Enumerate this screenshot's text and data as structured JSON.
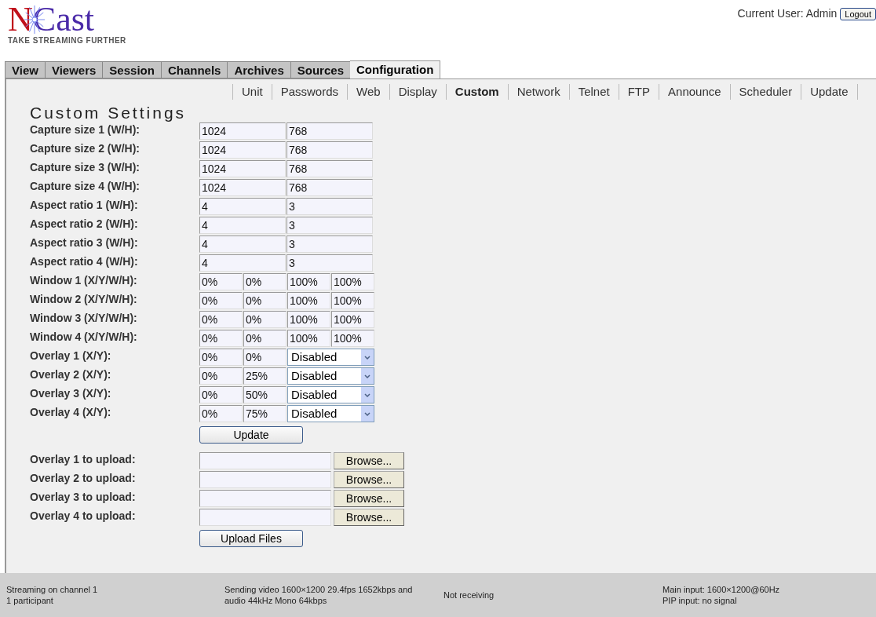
{
  "logo": {
    "name": "NCast",
    "tagline": "TAKE STREAMING FURTHER"
  },
  "user": {
    "label": "Current User: Admin",
    "logout": "Logout"
  },
  "tabs": [
    {
      "label": "View",
      "selected": false
    },
    {
      "label": "Viewers",
      "selected": false
    },
    {
      "label": "Session",
      "selected": false
    },
    {
      "label": "Channels",
      "selected": false
    },
    {
      "label": "Archives",
      "selected": false
    },
    {
      "label": "Sources",
      "selected": false
    },
    {
      "label": "Configuration",
      "selected": true
    }
  ],
  "subtabs": [
    {
      "label": "Unit",
      "selected": false
    },
    {
      "label": "Passwords",
      "selected": false
    },
    {
      "label": "Web",
      "selected": false
    },
    {
      "label": "Display",
      "selected": false
    },
    {
      "label": "Custom",
      "selected": true
    },
    {
      "label": "Network",
      "selected": false
    },
    {
      "label": "Telnet",
      "selected": false
    },
    {
      "label": "FTP",
      "selected": false
    },
    {
      "label": "Announce",
      "selected": false
    },
    {
      "label": "Scheduler",
      "selected": false
    },
    {
      "label": "Update",
      "selected": false
    }
  ],
  "title": "Custom Settings",
  "settings": [
    {
      "label": "Capture size 1 (W/H):",
      "fields": [
        {
          "kind": "wide",
          "value": "1024"
        },
        {
          "kind": "wide",
          "value": "768"
        }
      ]
    },
    {
      "label": "Capture size 2 (W/H):",
      "fields": [
        {
          "kind": "wide",
          "value": "1024"
        },
        {
          "kind": "wide",
          "value": "768"
        }
      ]
    },
    {
      "label": "Capture size 3 (W/H):",
      "fields": [
        {
          "kind": "wide",
          "value": "1024"
        },
        {
          "kind": "wide",
          "value": "768"
        }
      ]
    },
    {
      "label": "Capture size 4 (W/H):",
      "fields": [
        {
          "kind": "wide",
          "value": "1024"
        },
        {
          "kind": "wide",
          "value": "768"
        }
      ]
    },
    {
      "label": "Aspect ratio 1 (W/H):",
      "fields": [
        {
          "kind": "wide",
          "value": "4"
        },
        {
          "kind": "wide",
          "value": "3"
        }
      ]
    },
    {
      "label": "Aspect ratio 2 (W/H):",
      "fields": [
        {
          "kind": "wide",
          "value": "4"
        },
        {
          "kind": "wide",
          "value": "3"
        }
      ]
    },
    {
      "label": "Aspect ratio 3 (W/H):",
      "fields": [
        {
          "kind": "wide",
          "value": "4"
        },
        {
          "kind": "wide",
          "value": "3"
        }
      ]
    },
    {
      "label": "Aspect ratio 4 (W/H):",
      "fields": [
        {
          "kind": "wide",
          "value": "4"
        },
        {
          "kind": "wide",
          "value": "3"
        }
      ]
    },
    {
      "label": "Window 1 (X/Y/W/H):",
      "fields": [
        {
          "kind": "narrow",
          "value": "0%"
        },
        {
          "kind": "narrow",
          "value": "0%"
        },
        {
          "kind": "narrow",
          "value": "100%"
        },
        {
          "kind": "narrow",
          "value": "100%"
        }
      ]
    },
    {
      "label": "Window 2 (X/Y/W/H):",
      "fields": [
        {
          "kind": "narrow",
          "value": "0%"
        },
        {
          "kind": "narrow",
          "value": "0%"
        },
        {
          "kind": "narrow",
          "value": "100%"
        },
        {
          "kind": "narrow",
          "value": "100%"
        }
      ]
    },
    {
      "label": "Window 3 (X/Y/W/H):",
      "fields": [
        {
          "kind": "narrow",
          "value": "0%"
        },
        {
          "kind": "narrow",
          "value": "0%"
        },
        {
          "kind": "narrow",
          "value": "100%"
        },
        {
          "kind": "narrow",
          "value": "100%"
        }
      ]
    },
    {
      "label": "Window 4 (X/Y/W/H):",
      "fields": [
        {
          "kind": "narrow",
          "value": "0%"
        },
        {
          "kind": "narrow",
          "value": "0%"
        },
        {
          "kind": "narrow",
          "value": "100%"
        },
        {
          "kind": "narrow",
          "value": "100%"
        }
      ]
    },
    {
      "label": "Overlay 1 (X/Y):",
      "fields": [
        {
          "kind": "narrow",
          "value": "0%"
        },
        {
          "kind": "narrow",
          "value": "0%"
        },
        {
          "kind": "select",
          "value": "Disabled"
        }
      ]
    },
    {
      "label": "Overlay 2 (X/Y):",
      "fields": [
        {
          "kind": "narrow",
          "value": "0%"
        },
        {
          "kind": "narrow",
          "value": "25%"
        },
        {
          "kind": "select",
          "value": "Disabled"
        }
      ]
    },
    {
      "label": "Overlay 3 (X/Y):",
      "fields": [
        {
          "kind": "narrow",
          "value": "0%"
        },
        {
          "kind": "narrow",
          "value": "50%"
        },
        {
          "kind": "select",
          "value": "Disabled"
        }
      ]
    },
    {
      "label": "Overlay 4 (X/Y):",
      "fields": [
        {
          "kind": "narrow",
          "value": "0%"
        },
        {
          "kind": "narrow",
          "value": "75%"
        },
        {
          "kind": "select",
          "value": "Disabled"
        }
      ]
    }
  ],
  "update_button": "Update",
  "uploads": [
    {
      "label": "Overlay 1 to upload:",
      "button": "Browse..."
    },
    {
      "label": "Overlay 2 to upload:",
      "button": "Browse..."
    },
    {
      "label": "Overlay 3 to upload:",
      "button": "Browse..."
    },
    {
      "label": "Overlay 4 to upload:",
      "button": "Browse..."
    }
  ],
  "upload_button": "Upload Files",
  "status_bar": [
    {
      "lines": [
        "Streaming on channel 1",
        "1 participant"
      ]
    },
    {
      "lines": [
        "Sending video 1600×1200 29.4fps 1652kbps and",
        "audio 44kHz Mono 64kbps"
      ]
    },
    {
      "lines": [
        "Not receiving"
      ]
    },
    {
      "lines": [
        "Main input: 1600×1200@60Hz",
        "PIP input: no signal"
      ]
    }
  ]
}
